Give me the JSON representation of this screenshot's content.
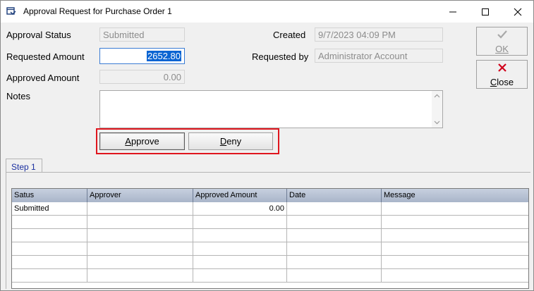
{
  "window": {
    "title": "Approval Request for Purchase Order 1"
  },
  "form": {
    "approval_status_label": "Approval Status",
    "approval_status_value": "Submitted",
    "requested_amount_label": "Requested Amount",
    "requested_amount_value": "2652.80",
    "approved_amount_label": "Approved Amount",
    "approved_amount_value": "0.00",
    "notes_label": "Notes",
    "notes_value": "",
    "created_label": "Created",
    "created_value": "9/7/2023 04:09 PM",
    "requested_by_label": "Requested by",
    "requested_by_value": "Administrator Account"
  },
  "actions": {
    "approve_label": "Approve",
    "deny_label": "Deny",
    "ok_label": "OK",
    "close_label": "Close"
  },
  "tabs": [
    {
      "label": "Step 1",
      "active": true
    }
  ],
  "grid": {
    "columns": [
      "Satus",
      "Approver",
      "Approved Amount",
      "Date",
      "Message"
    ],
    "rows": [
      [
        "Submitted",
        "",
        "0.00",
        "",
        ""
      ],
      [
        "",
        "",
        "",
        "",
        ""
      ],
      [
        "",
        "",
        "",
        "",
        ""
      ],
      [
        "",
        "",
        "",
        "",
        ""
      ],
      [
        "",
        "",
        "",
        "",
        ""
      ],
      [
        "",
        "",
        "",
        "",
        ""
      ]
    ]
  },
  "colors": {
    "highlight_border": "#e0161e",
    "selection": "#0a64d2",
    "tab_text": "#1a2fa0",
    "close_icon": "#d0021b"
  }
}
